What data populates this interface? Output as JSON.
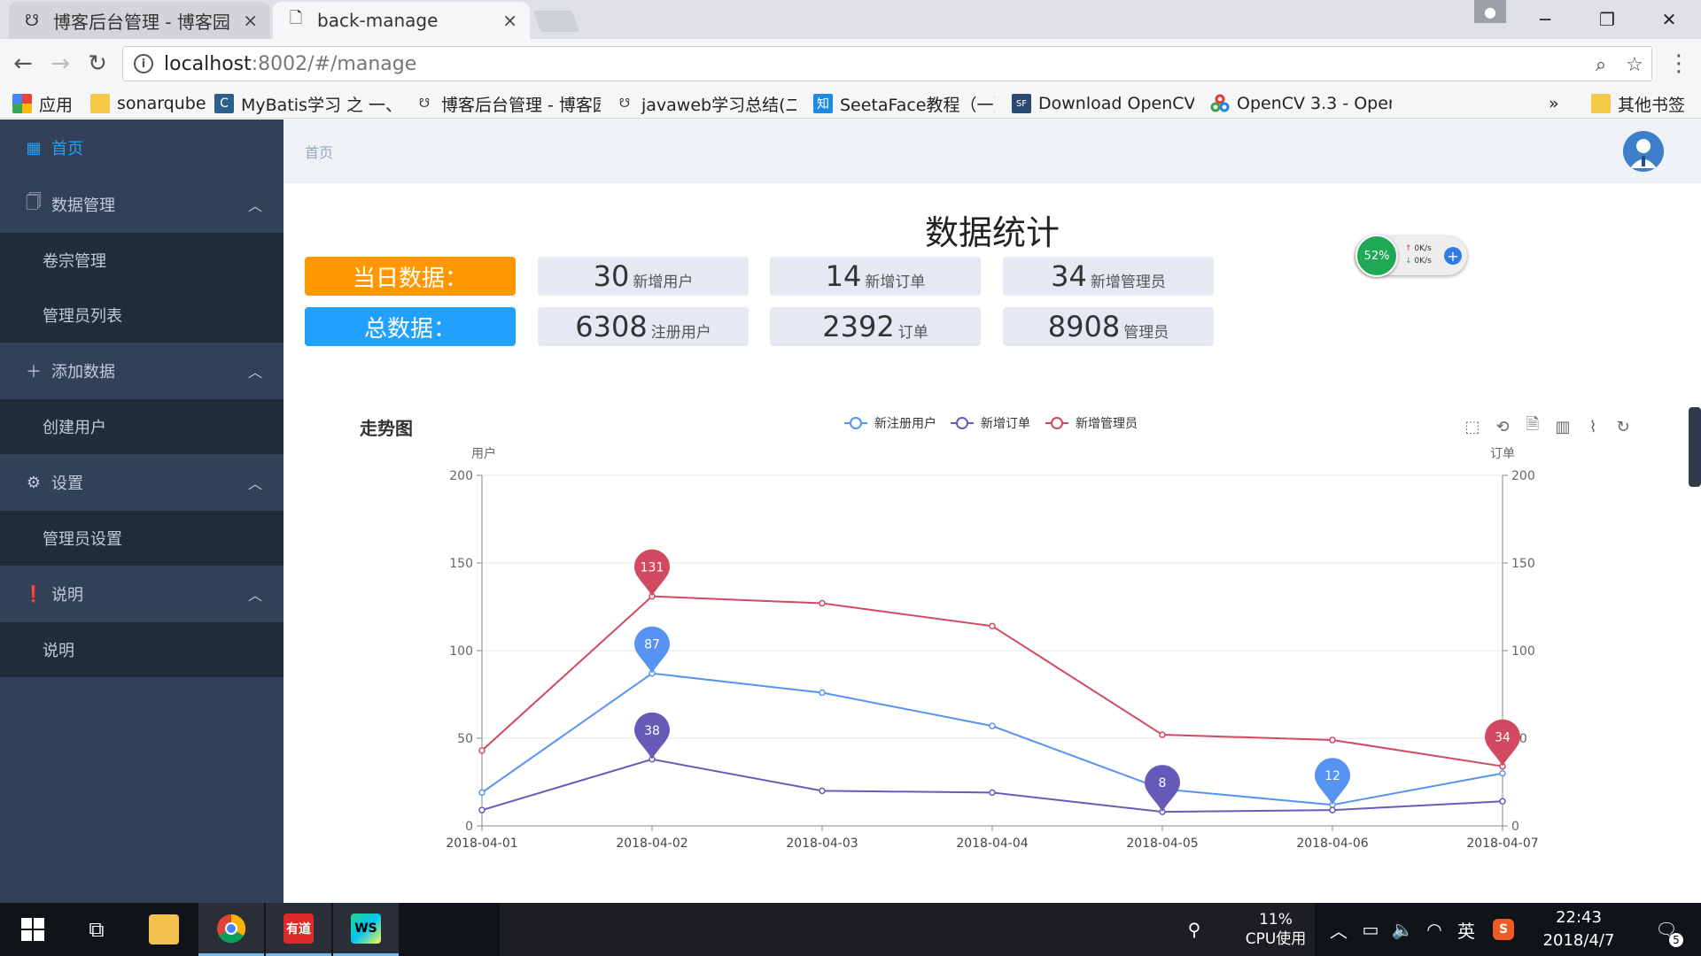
{
  "browser": {
    "tabs": [
      {
        "title": "博客后台管理 - 博客园",
        "active": false
      },
      {
        "title": "back-manage",
        "active": true
      }
    ],
    "url_host": "localhost",
    "url_path": ":8002/#/manage",
    "bookmarks": [
      {
        "label": "应用"
      },
      {
        "label": "sonarqube"
      },
      {
        "label": "MyBatis学习 之 一、"
      },
      {
        "label": "博客后台管理 - 博客园"
      },
      {
        "label": "javaweb学习总结(二"
      },
      {
        "label": "SeetaFace教程（一）"
      },
      {
        "label": "Download OpenCV"
      },
      {
        "label": "OpenCV 3.3 - OpenC"
      },
      {
        "label": "»"
      },
      {
        "label": "其他书签"
      }
    ]
  },
  "sidebar": {
    "home": "首页",
    "groups": [
      {
        "label": "数据管理",
        "items": [
          "卷宗管理",
          "管理员列表"
        ]
      },
      {
        "label": "添加数据",
        "items": [
          "创建用户"
        ]
      },
      {
        "label": "设置",
        "items": [
          "管理员设置"
        ]
      },
      {
        "label": "说明",
        "items": [
          "说明"
        ]
      }
    ]
  },
  "header": {
    "breadcrumb": "首页"
  },
  "stats": {
    "title": "数据统计",
    "today_label": "当日数据：",
    "total_label": "总数据：",
    "today": [
      {
        "value": "30",
        "unit": "新增用户"
      },
      {
        "value": "14",
        "unit": "新增订单"
      },
      {
        "value": "34",
        "unit": "新增管理员"
      }
    ],
    "total": [
      {
        "value": "6308",
        "unit": "注册用户"
      },
      {
        "value": "2392",
        "unit": "订单"
      },
      {
        "value": "8908",
        "unit": "管理员"
      }
    ],
    "colors": {
      "today": "#ff9800",
      "total": "#20a0ff"
    }
  },
  "net_widget": {
    "percent": "52%",
    "up": "0K/s",
    "down": "0K/s"
  },
  "chart_data": {
    "type": "line",
    "title": "走势图",
    "x": [
      "2018-04-01",
      "2018-04-02",
      "2018-04-03",
      "2018-04-04",
      "2018-04-05",
      "2018-04-06",
      "2018-04-07"
    ],
    "ylabel": "用户",
    "y2label": "订单",
    "ylim": [
      0,
      200
    ],
    "y2lim": [
      0,
      200
    ],
    "yticks": [
      0,
      50,
      100,
      150,
      200
    ],
    "legend_position": "top-center",
    "series": [
      {
        "name": "新注册用户",
        "color": "#5793f3",
        "values": [
          19,
          87,
          76,
          57,
          21,
          12,
          30
        ],
        "markers": [
          {
            "index": 1,
            "label": "87"
          },
          {
            "index": 5,
            "label": "12"
          }
        ]
      },
      {
        "name": "新增订单",
        "color": "#675bba",
        "values": [
          9,
          38,
          20,
          19,
          8,
          9,
          14
        ],
        "markers": [
          {
            "index": 1,
            "label": "38"
          },
          {
            "index": 4,
            "label": "8"
          }
        ]
      },
      {
        "name": "新增管理员",
        "color": "#d14a61",
        "values": [
          43,
          131,
          127,
          114,
          52,
          49,
          34
        ],
        "markers": [
          {
            "index": 1,
            "label": "131"
          },
          {
            "index": 6,
            "label": "34"
          }
        ]
      }
    ]
  },
  "taskbar": {
    "cpu_percent": "11%",
    "cpu_label": "CPU使用",
    "ime": "英",
    "time": "22:43",
    "date": "2018/4/7",
    "notifications": "5",
    "apps": [
      "有道",
      "WS"
    ]
  }
}
